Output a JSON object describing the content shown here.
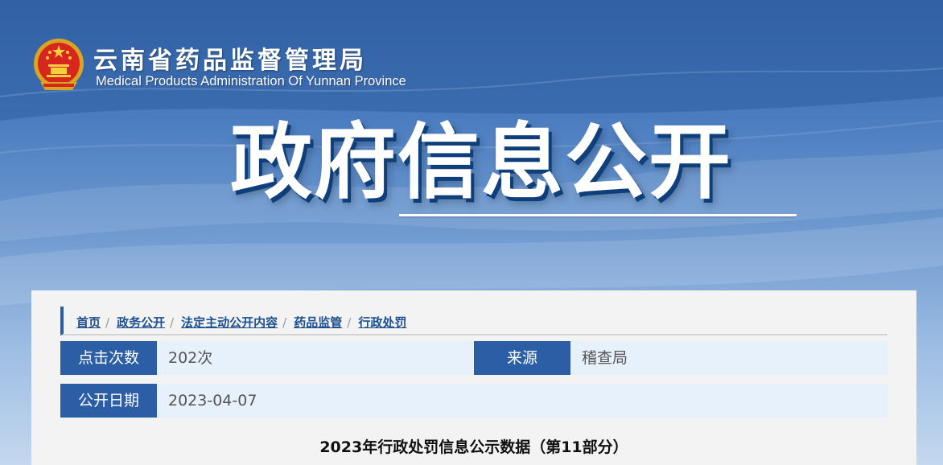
{
  "header": {
    "site_title_cn": "云南省药品监督管理局",
    "site_title_en": "Medical Products Administration Of Yunnan Province",
    "logo_icon": "national-emblem-icon"
  },
  "hero": {
    "title": "政府信息公开"
  },
  "breadcrumb": {
    "items": [
      {
        "label": "首页"
      },
      {
        "label": "政务公开"
      },
      {
        "label": "法定主动公开内容"
      },
      {
        "label": "药品监管"
      },
      {
        "label": "行政处罚"
      }
    ],
    "separator": "/"
  },
  "meta": {
    "clicks_label": "点击次数",
    "clicks_value": "202次",
    "source_label": "来源",
    "source_value": "稽查局",
    "date_label": "公开日期",
    "date_value": "2023-04-07"
  },
  "article": {
    "title": "2023年行政处罚信息公示数据（第11部分）"
  },
  "colors": {
    "primary": "#2b5ea5",
    "link": "#1d4f91",
    "row_bg": "#e6f1fb",
    "panel_bg": "#f3f3f3"
  }
}
